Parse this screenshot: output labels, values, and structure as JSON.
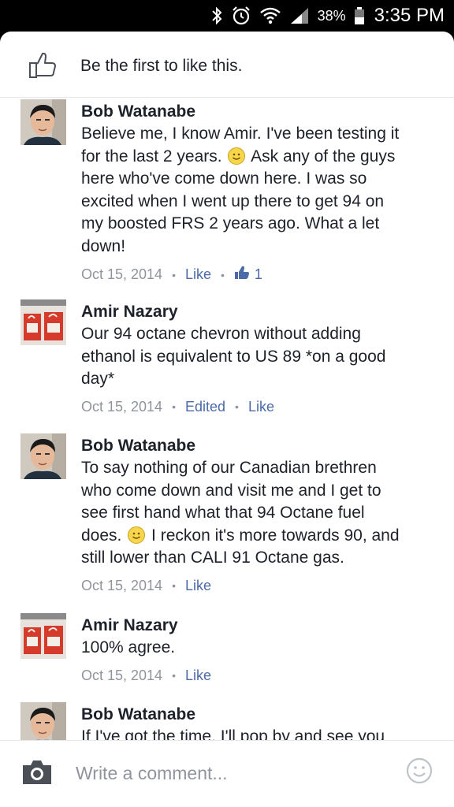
{
  "status_bar": {
    "battery_percent": "38%",
    "time": "3:35 PM",
    "icons": [
      "bluetooth-icon",
      "alarm-icon",
      "wifi-icon",
      "signal-icon",
      "battery-icon"
    ]
  },
  "likes_bar": {
    "text": "Be the first to like this.",
    "icon": "thumbs-up-icon"
  },
  "comments": [
    {
      "author": "Bob Watanabe",
      "lines": [
        "Believe me, I know Amir. I've been testing it",
        "for the last 2 years. [smiley] Ask any of the guys",
        "here who've come down here. I was so",
        "excited when I went up there to get 94 on",
        "my boosted FRS 2 years ago. What a let",
        "down!"
      ],
      "date": "Oct 15, 2014",
      "actions": [
        "Like"
      ],
      "like_count": "1"
    },
    {
      "author": "Amir Nazary",
      "lines": [
        "Our 94 octane chevron without adding",
        "ethanol is equivalent to US 89 *on a good",
        "day*"
      ],
      "date": "Oct 15, 2014",
      "actions": [
        "Edited",
        "Like"
      ]
    },
    {
      "author": "Bob Watanabe",
      "lines": [
        "To say nothing of our Canadian brethren",
        "who come down and visit me and I get to",
        "see first hand what that 94 Octane fuel",
        "does. [smiley] I reckon it's more towards 90, and",
        "still lower than CALI 91 Octane gas."
      ],
      "date": "Oct 15, 2014",
      "actions": [
        "Like"
      ]
    },
    {
      "author": "Amir Nazary",
      "lines": [
        "100% agree."
      ],
      "date": "Oct 15, 2014",
      "actions": [
        "Like"
      ]
    },
    {
      "author": "Bob Watanabe",
      "lines": [
        "If I've got the time. I'll pop by and see you"
      ],
      "date": "",
      "actions": []
    }
  ],
  "composer": {
    "placeholder": "Write a comment...",
    "camera_icon": "camera-icon",
    "emoji_icon": "smiley-icon"
  },
  "colors": {
    "link": "#4b6aa8",
    "meta": "#90949c",
    "text": "#1d2129"
  }
}
